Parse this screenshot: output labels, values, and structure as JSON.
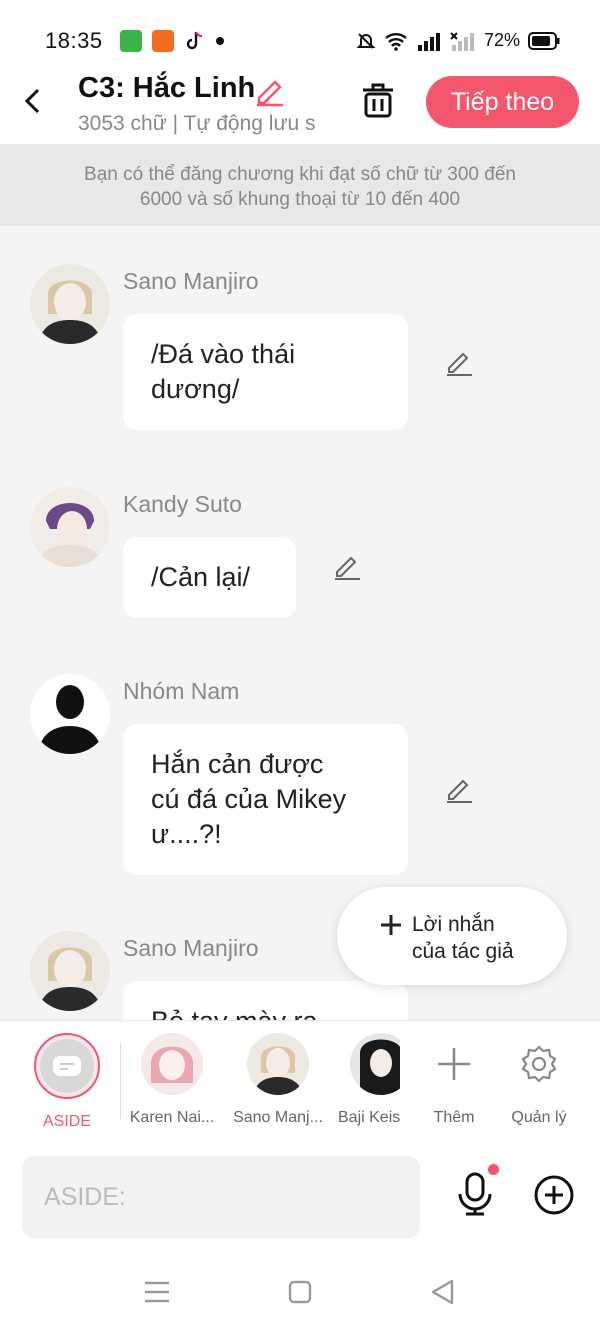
{
  "status": {
    "time": "18:35",
    "battery": "72%"
  },
  "header": {
    "title": "C3: Hắc Linh",
    "subtitle": "3053 chữ | Tự động lưu s",
    "next_label": "Tiếp theo"
  },
  "notice": {
    "line1": "Bạn có thể đăng chương khi đạt số chữ từ 300 đến",
    "line2": "6000 và số khung thoại từ 10 đến 400"
  },
  "messages": [
    {
      "name": "Sano Manjiro",
      "line1": "/Đá vào thái",
      "line2": "dương/"
    },
    {
      "name": "Kandy Suto",
      "line1": "/Cản lại/"
    },
    {
      "name": "Nhóm Nam",
      "line1": "Hắn cản được",
      "line2": "cú đá của Mikey",
      "line3": "ư....?!"
    },
    {
      "name": "Sano Manjiro",
      "line1": "Bỏ tay mày ra"
    }
  ],
  "author_button": {
    "line1": "Lời nhắn",
    "line2": "của tác giả"
  },
  "characters": [
    {
      "label": "ASIDE"
    },
    {
      "label": "Karen Nai..."
    },
    {
      "label": "Sano Manj..."
    },
    {
      "label": "Baji Keis"
    },
    {
      "label": "Thêm"
    },
    {
      "label": "Quản lý"
    }
  ],
  "input": {
    "placeholder": "ASIDE:"
  },
  "colors": {
    "accent": "#f4566d",
    "background": "#f4f4f4",
    "bubble": "#ffffff"
  }
}
